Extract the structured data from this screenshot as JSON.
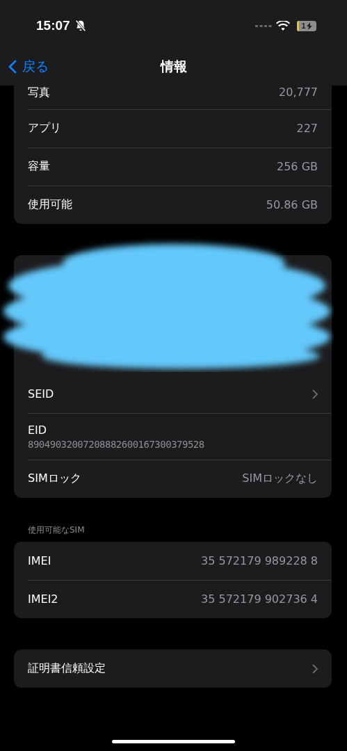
{
  "status_bar": {
    "time": "15:07",
    "silent": true,
    "battery_text": "1",
    "charging": true
  },
  "nav": {
    "back": "戻る",
    "title": "情報"
  },
  "groups": [
    {
      "rows": [
        {
          "label": "写真",
          "value": "20,777"
        },
        {
          "label": "アプリ",
          "value": "227"
        },
        {
          "label": "容量",
          "value": "256 GB"
        },
        {
          "label": "使用可能",
          "value": "50.86 GB"
        }
      ]
    },
    {
      "redacted": true,
      "rows": [
        {
          "label": "SEID",
          "chevron": true
        },
        {
          "label": "EID",
          "detail": "89049032007208882600167300379528"
        },
        {
          "label": "SIMロック",
          "value": "SIMロックなし"
        }
      ]
    },
    {
      "header": "使用可能なSIM",
      "rows": [
        {
          "label": "IMEI",
          "value": "35 572179 989228 8"
        },
        {
          "label": "IMEI2",
          "value": "35 572179 902736 4"
        }
      ]
    },
    {
      "rows": [
        {
          "label": "証明書信頼設定",
          "chevron": true
        }
      ]
    }
  ]
}
